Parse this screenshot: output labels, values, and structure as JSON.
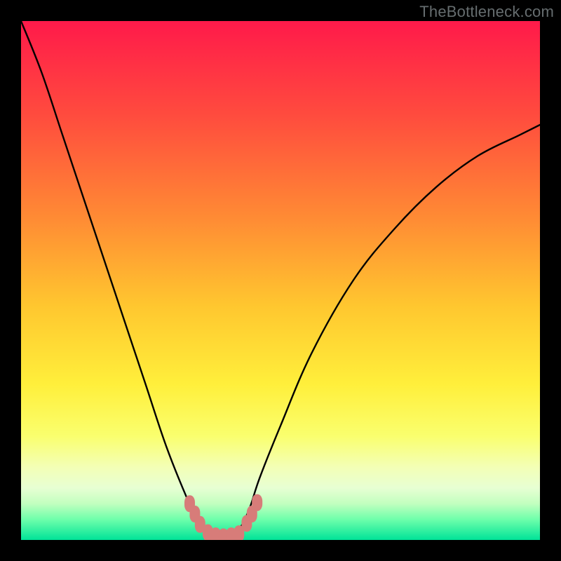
{
  "watermark": "TheBottleneck.com",
  "colors": {
    "frame": "#000000",
    "curve_stroke": "#000000",
    "marker_fill": "#d77c79",
    "gradient_stops": [
      {
        "pct": 0,
        "color": "#ff1a4a"
      },
      {
        "pct": 18,
        "color": "#ff4b3e"
      },
      {
        "pct": 38,
        "color": "#ff8b34"
      },
      {
        "pct": 55,
        "color": "#ffc72f"
      },
      {
        "pct": 70,
        "color": "#ffef3b"
      },
      {
        "pct": 80,
        "color": "#faff6e"
      },
      {
        "pct": 86,
        "color": "#f3ffb6"
      },
      {
        "pct": 90,
        "color": "#e7ffd3"
      },
      {
        "pct": 93,
        "color": "#c2ffbf"
      },
      {
        "pct": 96,
        "color": "#6fffab"
      },
      {
        "pct": 100,
        "color": "#00e398"
      }
    ]
  },
  "chart_data": {
    "type": "line",
    "title": "",
    "xlabel": "",
    "ylabel": "",
    "xlim": [
      0,
      100
    ],
    "ylim": [
      0,
      100
    ],
    "note": "x is normalized horizontal position (0=left edge of plot, 100=right). y is bottleneck severity percentage (0=bottom/green/no bottleneck, 100=top/red/max bottleneck). Values are visually estimated from pixel positions along the black V-curve.",
    "series": [
      {
        "name": "bottleneck-curve",
        "x": [
          0,
          4,
          8,
          12,
          16,
          20,
          24,
          28,
          32,
          34,
          36,
          38,
          39,
          40,
          42,
          44,
          46,
          50,
          56,
          64,
          72,
          80,
          88,
          96,
          100
        ],
        "y": [
          100,
          90,
          78,
          66,
          54,
          42,
          30,
          18,
          8,
          4,
          2,
          0.8,
          0.6,
          0.8,
          2,
          6,
          12,
          22,
          36,
          50,
          60,
          68,
          74,
          78,
          80
        ]
      }
    ],
    "markers": {
      "name": "near-zero-band",
      "note": "Pink rounded markers near the valley floor indicating near-optimal configurations.",
      "points": [
        {
          "x": 32.5,
          "y": 7
        },
        {
          "x": 33.5,
          "y": 5
        },
        {
          "x": 34.5,
          "y": 3
        },
        {
          "x": 36.0,
          "y": 1.4
        },
        {
          "x": 37.5,
          "y": 0.8
        },
        {
          "x": 39.0,
          "y": 0.6
        },
        {
          "x": 40.5,
          "y": 0.8
        },
        {
          "x": 42.0,
          "y": 1.2
        },
        {
          "x": 43.5,
          "y": 3.2
        },
        {
          "x": 44.5,
          "y": 5.0
        },
        {
          "x": 45.5,
          "y": 7.2
        }
      ]
    }
  }
}
